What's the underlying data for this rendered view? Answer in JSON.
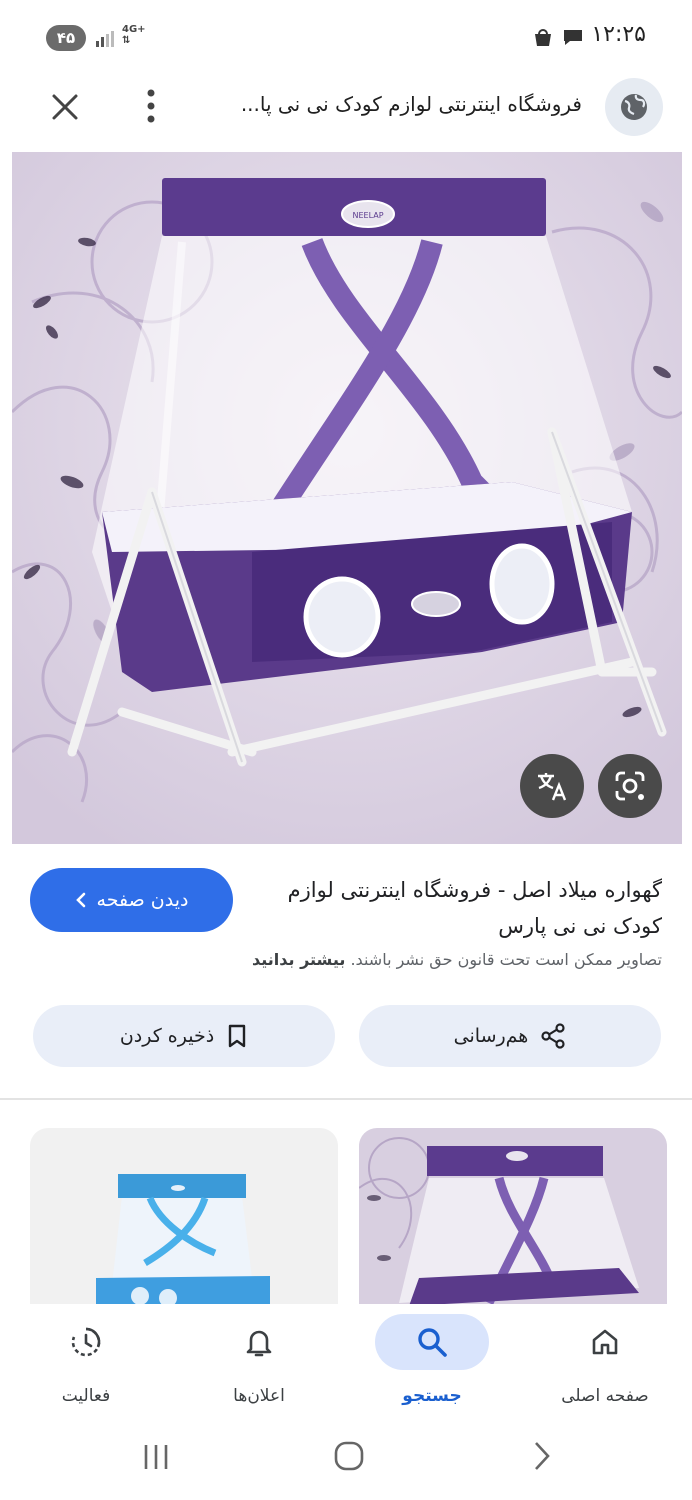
{
  "status_bar": {
    "time": "۱۲:۲۵",
    "battery": "۴۵",
    "network": "4G+"
  },
  "url_bar": {
    "title": "فروشگاه اینترنتی لوازم کودک نی نی پا...",
    "icons": [
      "globe-icon",
      "more-vert-icon",
      "close-icon"
    ]
  },
  "hero": {
    "brand_text": "NEELAP",
    "fab_icons": [
      "translate-icon",
      "lens-search-icon"
    ],
    "colors": {
      "canopy": "#5b3b8e",
      "background": "#ddd4e4",
      "frame": "#f2f2f2"
    }
  },
  "result": {
    "title": "گهواره میلاد اصل - فروشگاه اینترنتی لوازم کودک نی نی پارس",
    "visit_label": "دیدن صفحه",
    "copyright": "تصاویر ممکن است تحت قانون حق نشر باشند.",
    "learn_more": "بیشتر بدانید"
  },
  "actions": {
    "share_label": "هم‌رسانی",
    "save_label": "ذخیره کردن"
  },
  "bottom_nav": {
    "items": [
      {
        "label": "صفحه اصلی",
        "icon": "home-icon"
      },
      {
        "label": "جستجو",
        "icon": "search-icon",
        "active": true
      },
      {
        "label": "اعلان‌ها",
        "icon": "bell-icon"
      },
      {
        "label": "فعالیت",
        "icon": "activity-icon"
      }
    ],
    "accent": "#1a5fcf"
  },
  "system_nav": [
    "recents-icon",
    "home-circle-icon",
    "back-icon"
  ]
}
